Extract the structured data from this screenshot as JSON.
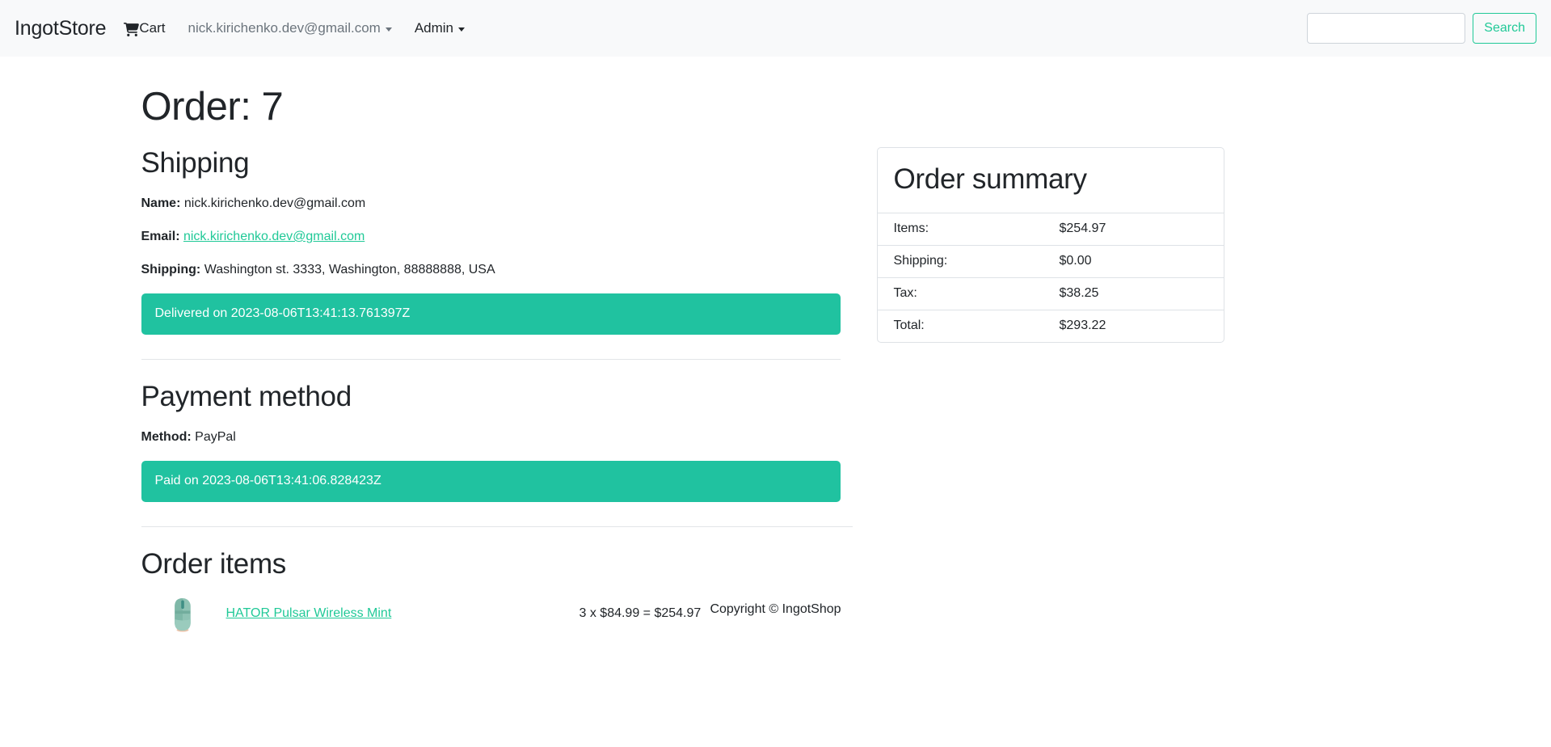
{
  "navbar": {
    "brand": "IngotStore",
    "cart_label": "Cart",
    "cart_icon": "shopping-cart-icon",
    "user_menu_label": "nick.kirichenko.dev@gmail.com",
    "admin_menu_label": "Admin",
    "search_placeholder": "",
    "search_value": "",
    "search_button_label": "Search",
    "accent_color": "#20c997",
    "background_color": "#f8f9fa"
  },
  "page": {
    "title": "Order: 7"
  },
  "shipping": {
    "heading": "Shipping",
    "name_label": "Name:",
    "name_value": "nick.kirichenko.dev@gmail.com",
    "email_label": "Email:",
    "email_value": "nick.kirichenko.dev@gmail.com",
    "address_label": "Shipping:",
    "address_value": "Washington st. 3333, Washington, 88888888, USA",
    "status_alert": "Delivered on 2023-08-06T13:41:13.761397Z",
    "status_color": "#20c2a0"
  },
  "payment": {
    "heading": "Payment method",
    "method_label": "Method:",
    "method_value": "PayPal",
    "status_alert": "Paid on 2023-08-06T13:41:06.828423Z",
    "status_color": "#20c2a0"
  },
  "order_items": {
    "heading": "Order items",
    "items": [
      {
        "thumbnail": "mouse-thumbnail",
        "name": "HATOR Pulsar Wireless Mint",
        "qty_line": "3 x $84.99 = $254.97"
      }
    ]
  },
  "order_summary": {
    "heading": "Order summary",
    "rows": [
      {
        "label": "Items:",
        "value": "$254.97"
      },
      {
        "label": "Shipping:",
        "value": "$0.00"
      },
      {
        "label": "Tax:",
        "value": "$38.25"
      },
      {
        "label": "Total:",
        "value": "$293.22"
      }
    ]
  },
  "footer": {
    "copyright": "Copyright © IngotShop"
  }
}
